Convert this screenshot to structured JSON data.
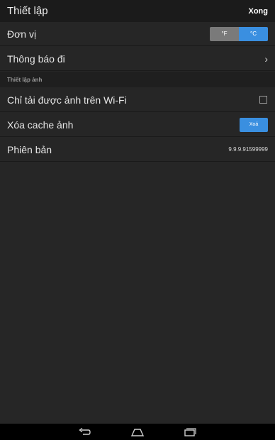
{
  "header": {
    "title": "Thiết lập",
    "done_label": "Xong"
  },
  "units": {
    "label": "Đơn vị",
    "fahrenheit": "°F",
    "celsius": "°C",
    "selected": "°C"
  },
  "notifications": {
    "label": "Thông báo đi"
  },
  "image_section": {
    "title": "Thiết lập ảnh"
  },
  "wifi_only": {
    "label": "Chỉ tải được ảnh trên Wi-Fi",
    "checked": false
  },
  "clear_cache": {
    "label": "Xóa cache ảnh",
    "button_label": "Xoá"
  },
  "version": {
    "label": "Phiên bản",
    "value": "9.9.9.91599999"
  },
  "colors": {
    "accent": "#3a8fe0",
    "background": "#262626",
    "header": "#1b1b1b"
  },
  "icons": {
    "chevron": "chevron-right-icon",
    "nav_back": "back-icon",
    "nav_home": "home-icon",
    "nav_recents": "recents-icon"
  }
}
